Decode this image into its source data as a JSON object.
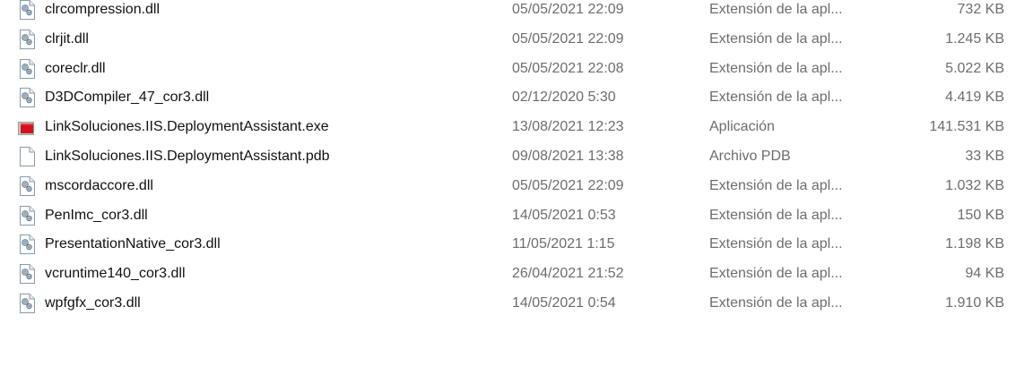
{
  "files": [
    {
      "name": "clrcompression.dll",
      "date": "05/05/2021 22:09",
      "type": "Extensión de la apl...",
      "size": "732 KB",
      "icon": "dll-file-icon"
    },
    {
      "name": "clrjit.dll",
      "date": "05/05/2021 22:09",
      "type": "Extensión de la apl...",
      "size": "1.245 KB",
      "icon": "dll-file-icon"
    },
    {
      "name": "coreclr.dll",
      "date": "05/05/2021 22:08",
      "type": "Extensión de la apl...",
      "size": "5.022 KB",
      "icon": "dll-file-icon"
    },
    {
      "name": "D3DCompiler_47_cor3.dll",
      "date": "02/12/2020 5:30",
      "type": "Extensión de la apl...",
      "size": "4.419 KB",
      "icon": "dll-file-icon"
    },
    {
      "name": "LinkSoluciones.IIS.DeploymentAssistant.exe",
      "date": "13/08/2021 12:23",
      "type": "Aplicación",
      "size": "141.531 KB",
      "icon": "exe-app-icon"
    },
    {
      "name": "LinkSoluciones.IIS.DeploymentAssistant.pdb",
      "date": "09/08/2021 13:38",
      "type": "Archivo PDB",
      "size": "33 KB",
      "icon": "blank-file-icon"
    },
    {
      "name": "mscordaccore.dll",
      "date": "05/05/2021 22:09",
      "type": "Extensión de la apl...",
      "size": "1.032 KB",
      "icon": "dll-file-icon"
    },
    {
      "name": "PenImc_cor3.dll",
      "date": "14/05/2021 0:53",
      "type": "Extensión de la apl...",
      "size": "150 KB",
      "icon": "dll-file-icon"
    },
    {
      "name": "PresentationNative_cor3.dll",
      "date": "11/05/2021 1:15",
      "type": "Extensión de la apl...",
      "size": "1.198 KB",
      "icon": "dll-file-icon"
    },
    {
      "name": "vcruntime140_cor3.dll",
      "date": "26/04/2021 21:52",
      "type": "Extensión de la apl...",
      "size": "94 KB",
      "icon": "dll-file-icon"
    },
    {
      "name": "wpfgfx_cor3.dll",
      "date": "14/05/2021 0:54",
      "type": "Extensión de la apl...",
      "size": "1.910 KB",
      "icon": "dll-file-icon"
    }
  ]
}
